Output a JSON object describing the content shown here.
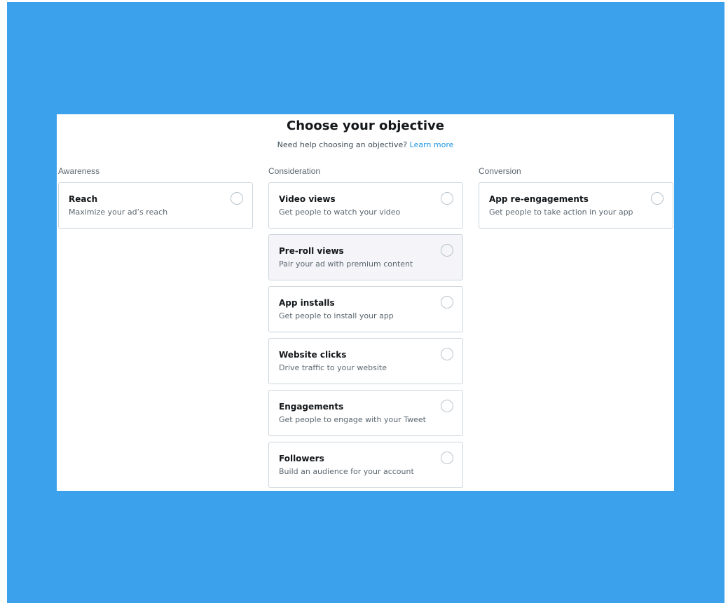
{
  "header": {
    "title": "Choose your objective",
    "help_text": "Need help choosing an objective?",
    "learn_more_label": "Learn more"
  },
  "colors": {
    "background": "#3ca1ec",
    "link": "#1b95e0",
    "highlighted_card": "#f4f4f9"
  },
  "columns": {
    "awareness": {
      "heading": "Awareness",
      "options": [
        {
          "title": "Reach",
          "description": "Maximize your ad’s reach",
          "selected": false
        }
      ]
    },
    "consideration": {
      "heading": "Consideration",
      "options": [
        {
          "title": "Video views",
          "description": "Get people to watch your video",
          "selected": false
        },
        {
          "title": "Pre-roll views",
          "description": "Pair your ad with premium content",
          "selected": false,
          "highlighted": true
        },
        {
          "title": "App installs",
          "description": "Get people to install your app",
          "selected": false
        },
        {
          "title": "Website clicks",
          "description": "Drive traffic to your website",
          "selected": false
        },
        {
          "title": "Engagements",
          "description": "Get people to engage with your Tweet",
          "selected": false
        },
        {
          "title": "Followers",
          "description": "Build an audience for your account",
          "selected": false
        }
      ]
    },
    "conversion": {
      "heading": "Conversion",
      "options": [
        {
          "title": "App re-engagements",
          "description": "Get people to take action in your app",
          "selected": false
        }
      ]
    }
  }
}
